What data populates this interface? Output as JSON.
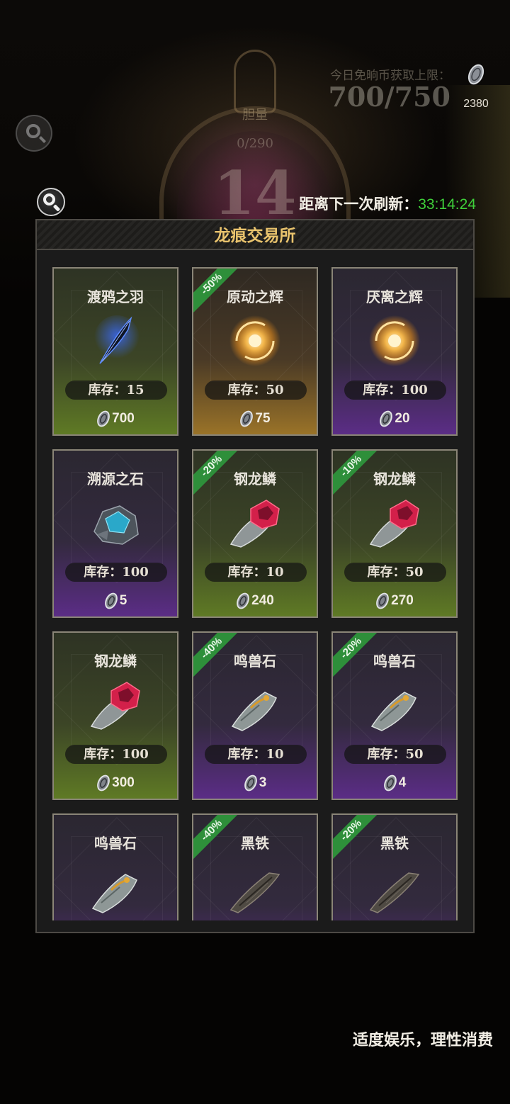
{
  "header": {
    "cap_label": "今日免晌币获取上限：",
    "cap_value": "700/750",
    "currency_amount": "2380",
    "rank_label": "胆量",
    "rank_count": "0/290",
    "rank_level": "14",
    "refresh_label": "距离下一次刷新：",
    "refresh_time": "33:14:24"
  },
  "shop": {
    "title": "龙痕交易所",
    "items": [
      {
        "name": "渡鸦之羽",
        "stock": "库存：15",
        "price": "700",
        "rarity": "green",
        "discount": "",
        "icon": "raven-feather-icon"
      },
      {
        "name": "原动之辉",
        "stock": "库存：50",
        "price": "75",
        "rarity": "orange",
        "discount": "-50%",
        "icon": "glowing-orb-icon"
      },
      {
        "name": "厌离之辉",
        "stock": "库存：100",
        "price": "20",
        "rarity": "purple",
        "discount": "",
        "icon": "glowing-orb-icon"
      },
      {
        "name": "溯源之石",
        "stock": "库存：100",
        "price": "5",
        "rarity": "purple",
        "discount": "",
        "icon": "blue-ore-icon"
      },
      {
        "name": "钢龙鳞",
        "stock": "库存：10",
        "price": "240",
        "rarity": "green",
        "discount": "-20%",
        "icon": "red-crystal-scale-icon"
      },
      {
        "name": "钢龙鳞",
        "stock": "库存：50",
        "price": "270",
        "rarity": "green",
        "discount": "-10%",
        "icon": "red-crystal-scale-icon"
      },
      {
        "name": "钢龙鳞",
        "stock": "库存：100",
        "price": "300",
        "rarity": "green",
        "discount": "",
        "icon": "red-crystal-scale-icon"
      },
      {
        "name": "鸣兽石",
        "stock": "库存：10",
        "price": "3",
        "rarity": "purple",
        "discount": "-40%",
        "icon": "beast-stone-icon"
      },
      {
        "name": "鸣兽石",
        "stock": "库存：50",
        "price": "4",
        "rarity": "purple",
        "discount": "-20%",
        "icon": "beast-stone-icon"
      },
      {
        "name": "鸣兽石",
        "stock": "",
        "price": "",
        "rarity": "purple",
        "discount": "",
        "icon": "beast-stone-icon"
      },
      {
        "name": "黑铁",
        "stock": "",
        "price": "",
        "rarity": "purple",
        "discount": "-40%",
        "icon": "black-iron-icon"
      },
      {
        "name": "黑铁",
        "stock": "",
        "price": "",
        "rarity": "purple",
        "discount": "-20%",
        "icon": "black-iron-icon"
      }
    ]
  },
  "footer": {
    "note": "适度娱乐，理性消费"
  },
  "colors": {
    "accent_title": "#e9c36d",
    "timer_green": "#3fcf3a",
    "discount_green": "#2e8f3a"
  }
}
